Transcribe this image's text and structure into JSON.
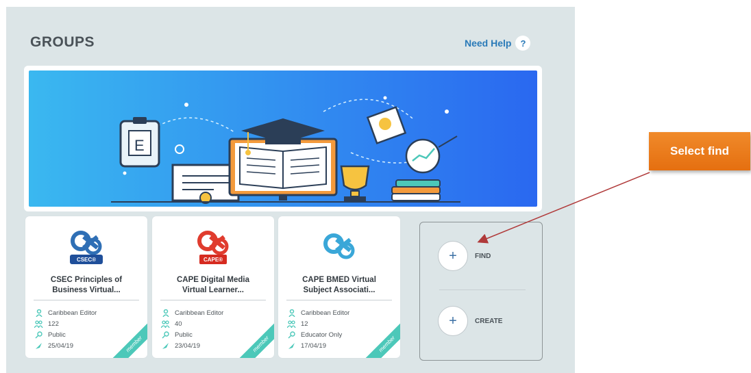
{
  "header": {
    "title": "GROUPS",
    "help_label": "Need Help",
    "help_icon_glyph": "?"
  },
  "banner": {
    "gradient_start": "#3ab8f0",
    "gradient_end": "#2a68f0",
    "clipboard_letter": "E"
  },
  "groups": [
    {
      "logo_badge": "CSEC®",
      "logo_color": "#2f6fb5",
      "name_line1": "CSEC Principles of",
      "name_line2": "Business Virtual...",
      "owner": "Caribbean Editor",
      "members": "122",
      "visibility": "Public",
      "date": "25/04/19",
      "ribbon": "member"
    },
    {
      "logo_badge": "CAPE®",
      "logo_color": "#e03c2e",
      "name_line1": "CAPE Digital Media",
      "name_line2": "Virtual Learner...",
      "owner": "Caribbean Editor",
      "members": "40",
      "visibility": "Public",
      "date": "23/04/19",
      "ribbon": "member"
    },
    {
      "logo_badge": "",
      "logo_color": "#3aa7d8",
      "name_line1": "CAPE BMED Virtual",
      "name_line2": "Subject Associati...",
      "owner": "Caribbean Editor",
      "members": "12",
      "visibility": "Educator Only",
      "date": "17/04/19",
      "ribbon": "member"
    }
  ],
  "actions": {
    "find_label": "FIND",
    "create_label": "CREATE",
    "plus_glyph": "+"
  },
  "callout": {
    "text": "Select find",
    "color": "#ef7f1f"
  },
  "colors": {
    "panel_bg": "#dce5e7",
    "accent_teal": "#4cc8b9",
    "link_blue": "#2a7ab8",
    "arrow_red": "#b03a3a"
  }
}
